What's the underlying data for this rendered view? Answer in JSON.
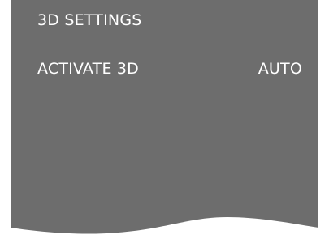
{
  "colors": {
    "menu_background": "#6d6d6d",
    "text": "#ffffff",
    "page_background": "#ffffff"
  },
  "menu": {
    "title": "3D SETTINGS",
    "items": [
      {
        "label": "ACTIVATE 3D",
        "value": "AUTO"
      }
    ]
  }
}
